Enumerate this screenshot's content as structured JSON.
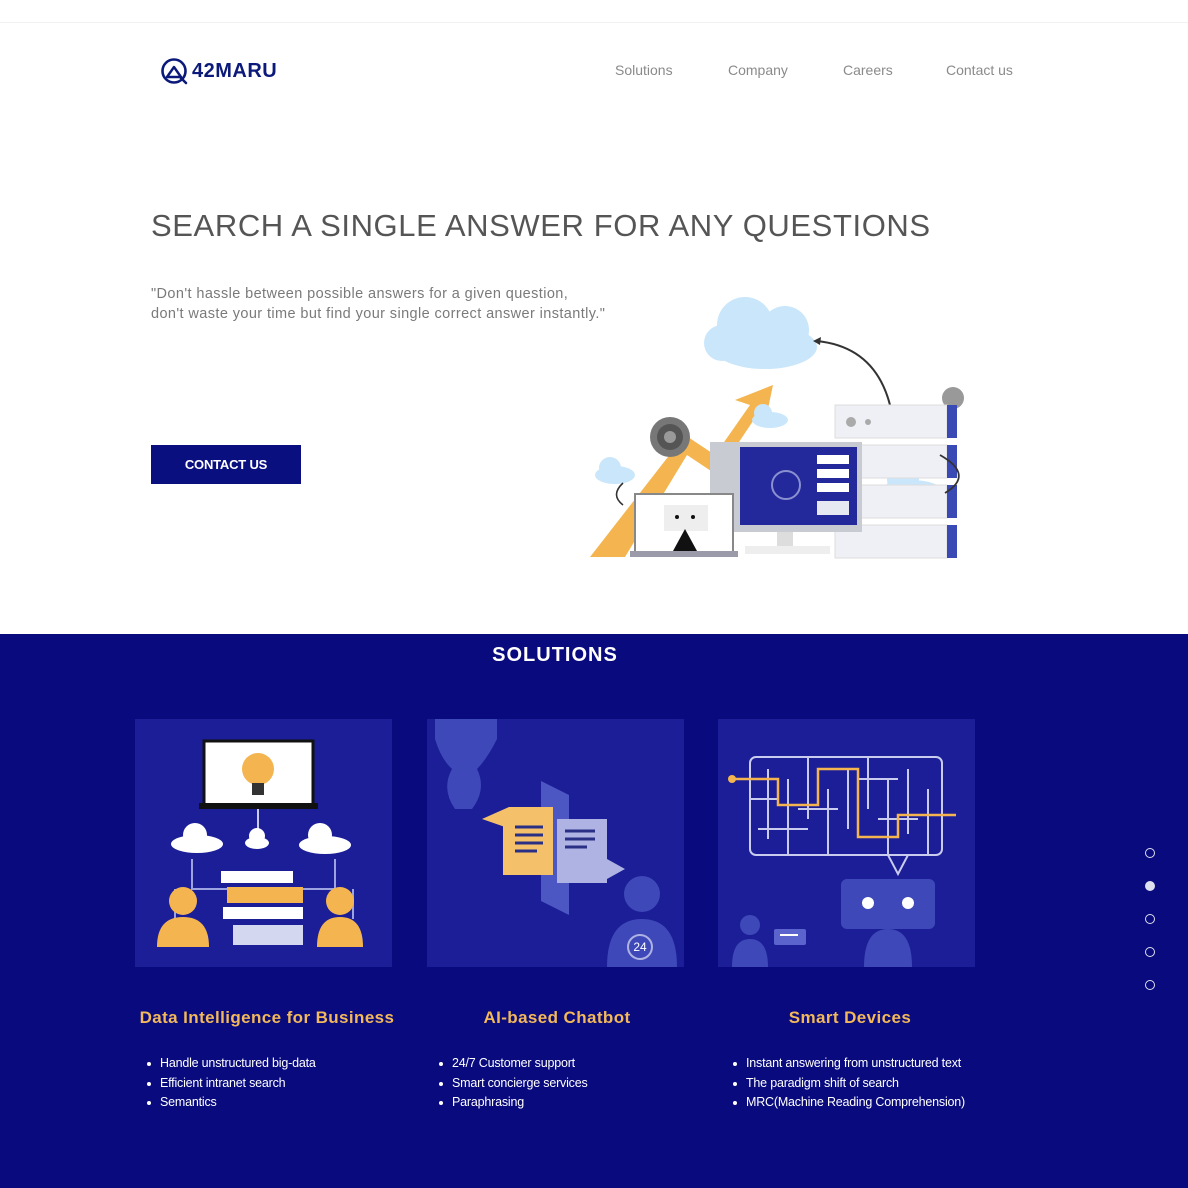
{
  "brand": {
    "name": "42MARU"
  },
  "nav": {
    "items": [
      "Solutions",
      "Company",
      "Careers",
      "Contact us"
    ]
  },
  "hero": {
    "title": "SEARCH A SINGLE ANSWER FOR ANY QUESTIONS",
    "quote_line1": "\"Don't hassle between possible answers for a given question,",
    "quote_line2": "don't waste your time but find your single correct answer instantly.\"",
    "cta_label": "CONTACT US"
  },
  "solutions": {
    "title": "SOLUTIONS",
    "cards": [
      {
        "title": "Data Intelligence for Business",
        "bullets": [
          "Handle unstructured big-data",
          "Efficient intranet search",
          "Semantics"
        ]
      },
      {
        "title": "AI-based Chatbot",
        "bullets": [
          "24/7 Customer support",
          "Smart concierge services",
          "Paraphrasing"
        ],
        "badge": "24"
      },
      {
        "title": "Smart Devices",
        "bullets": [
          "Instant answering from unstructured text",
          "The paradigm shift of search",
          "MRC(Machine Reading Comprehension)"
        ]
      }
    ],
    "pager": {
      "count": 5,
      "active_index": 1
    }
  },
  "colors": {
    "brand_navy": "#0a0f80",
    "section_bg": "#080a7d",
    "card_bg": "#1b1e96",
    "accent_gold": "#f2b85a"
  },
  "icons": [
    "logo-mark-icon",
    "gear-icon",
    "cloud-icon",
    "server-icon",
    "monitor-icon",
    "laptop-icon",
    "lightbulb-icon",
    "robot-icon",
    "maze-icon"
  ]
}
